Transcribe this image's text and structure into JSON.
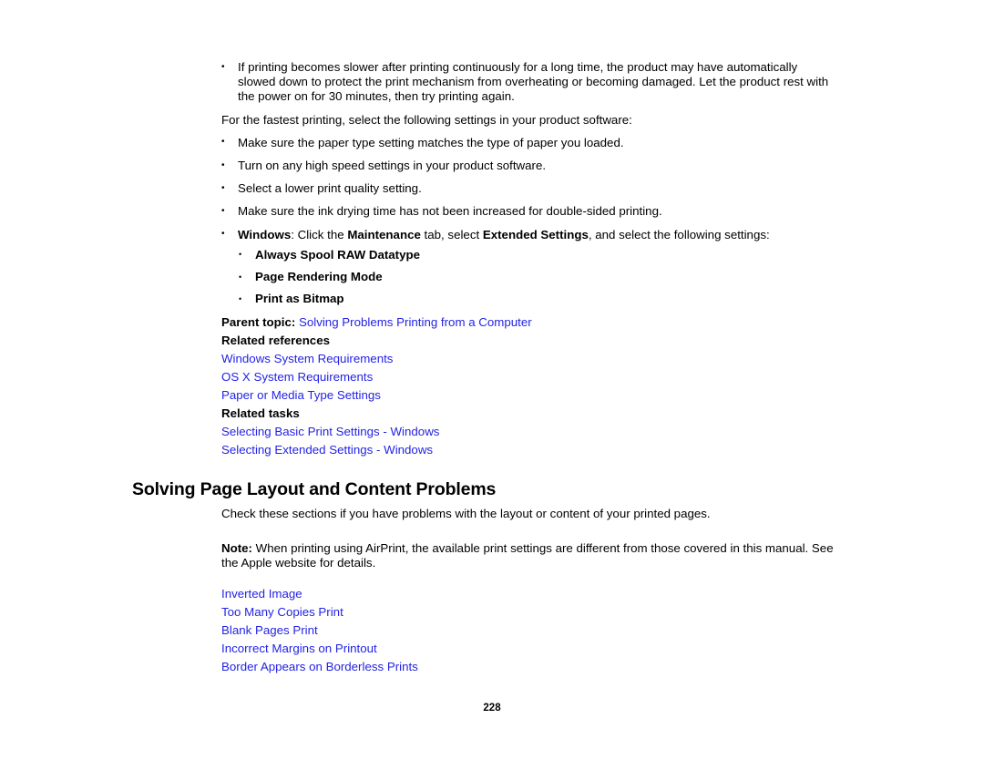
{
  "page": {
    "number": "228",
    "link_color": "#2323e6",
    "text_color": "#000000",
    "background": "#ffffff"
  },
  "top_section": {
    "bullets_before": [
      "If printing becomes slower after printing continuously for a long time, the product may have automatically slowed down to protect the print mechanism from overheating or becoming damaged. Let the product rest with the power on for 30 minutes, then try printing again."
    ],
    "intro_paragraph": "For the fastest printing, select the following settings in your product software:",
    "bullets": [
      "Make sure the paper type setting matches the type of paper you loaded.",
      "Turn on any high speed settings in your product software.",
      "Select a lower print quality setting.",
      "Make sure the ink drying time has not been increased for double-sided printing."
    ],
    "windows_bullet": {
      "lead_bold": "Windows",
      "text_1": ": Click the ",
      "bold_1": "Maintenance",
      "text_2": " tab, select ",
      "bold_2": "Extended Settings",
      "text_3": ", and select the following settings:"
    },
    "windows_sub_bullets": [
      "Always Spool RAW Datatype",
      "Page Rendering Mode",
      "Print as Bitmap"
    ]
  },
  "parent_topic": {
    "label": "Parent topic:",
    "link": "Solving Problems Printing from a Computer"
  },
  "related_references": {
    "heading": "Related references",
    "links": [
      "Windows System Requirements",
      "OS X System Requirements",
      "Paper or Media Type Settings"
    ]
  },
  "related_tasks": {
    "heading": "Related tasks",
    "links": [
      "Selecting Basic Print Settings - Windows",
      "Selecting Extended Settings - Windows"
    ]
  },
  "chapter": {
    "title": "Solving Page Layout and Content Problems",
    "intro": "Check these sections if you have problems with the layout or content of your printed pages.",
    "note": {
      "label": "Note:",
      "text": " When printing using AirPrint, the available print settings are different from those covered in this manual. See the Apple website for details."
    },
    "subtopic_links": [
      "Inverted Image",
      "Too Many Copies Print",
      "Blank Pages Print",
      "Incorrect Margins on Printout",
      "Border Appears on Borderless Prints"
    ]
  }
}
